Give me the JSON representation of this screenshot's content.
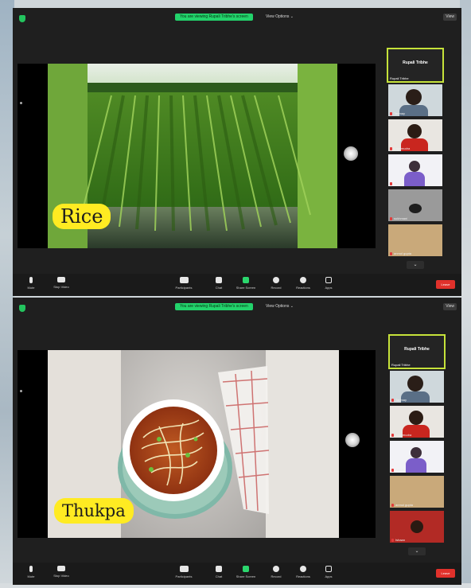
{
  "top": {
    "banner": "You are viewing Rupali Tribhe's screen",
    "view_options": "View Options ⌄",
    "view_btn": "View",
    "label": "Rice",
    "active_speaker": "Rupali Tribhe",
    "participants": [
      {
        "name": "Rupali Tribhe"
      },
      {
        "name": "Tanmay"
      },
      {
        "name": "Lopamudra"
      },
      {
        "name": "Shruti"
      },
      {
        "name": "sukhmani"
      },
      {
        "name": "anmol gupta"
      }
    ]
  },
  "bottom": {
    "banner": "You are viewing Rupali Tribhe's screen",
    "view_options": "View Options ⌄",
    "view_btn": "View",
    "label": "Thukpa",
    "active_speaker": "Rupali Tribhe",
    "participants": [
      {
        "name": "Rupali Tribhe"
      },
      {
        "name": "Tanmay"
      },
      {
        "name": "Lopamudra"
      },
      {
        "name": "Shruti"
      },
      {
        "name": "anmol gupta"
      },
      {
        "name": "Ishaan"
      }
    ]
  },
  "toolbar": {
    "mute": "Mute",
    "stop_video": "Stop Video",
    "participants": "Participants",
    "participants_count": "37",
    "chat": "Chat",
    "share": "Share Screen",
    "record": "Record",
    "reactions": "Reactions",
    "apps": "Apps",
    "leave": "Leave"
  },
  "colors": {
    "banner_green": "#22d36b",
    "active_border": "#c6e23a",
    "label_yellow": "#ffeb22",
    "leave_red": "#e0312b"
  }
}
